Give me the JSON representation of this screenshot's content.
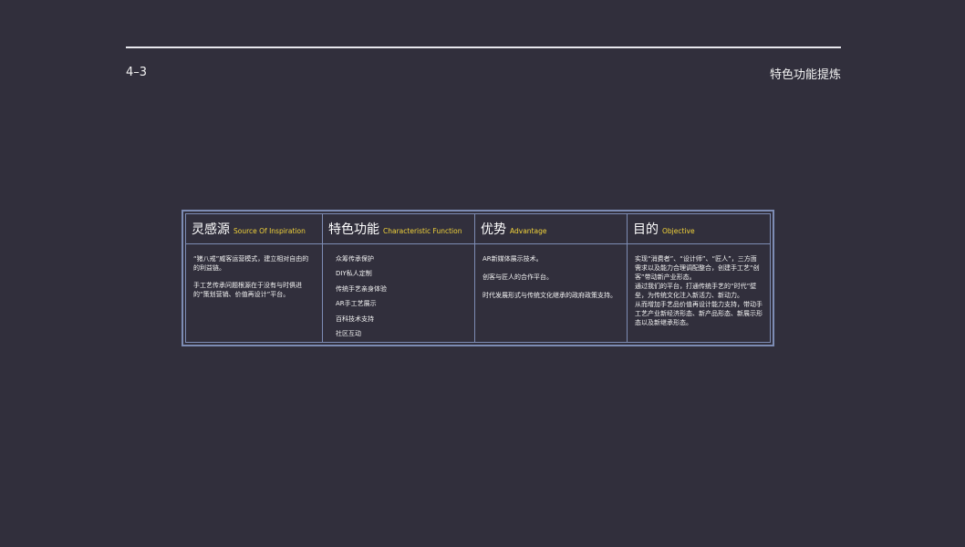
{
  "header": {
    "page_number": "4–3",
    "section_title": "特色功能提炼"
  },
  "table": {
    "columns": [
      {
        "title_zh": "灵感源",
        "title_en": "Source Of Inspiration",
        "paragraphs": [
          "“猪八戒”威客运营模式，建立相对自由的的利益链。",
          "手工艺传承问题根源在于没有与时俱进的“策划营销、价值再设计”平台。"
        ]
      },
      {
        "title_zh": "特色功能",
        "title_en": "Characteristic Function",
        "items": [
          "众筹传承保护",
          "DIY私人定制",
          "传统手艺亲身体验",
          "AR手工艺展示",
          "百科技术支持",
          "社区互动"
        ]
      },
      {
        "title_zh": "优势",
        "title_en": "Advantage",
        "paragraphs": [
          "AR新媒体展示技术。",
          "创客与匠人的合作平台。",
          "时代发展形式与传统文化继承的政府政策支持。"
        ]
      },
      {
        "title_zh": "目的",
        "title_en": "Objective",
        "paragraphs": [
          "实现“消费者”、“设计师”、“匠人”，三方面需求以及能力合理调配整合，创建手工艺“创客”带动新产业形态。",
          "通过我们的平台，打通传统手艺的“时代”壁垒，为传统文化注入新活力、新动力。",
          "从而增加手艺品价值再设计能力支持，带动手工艺产业新经济形态、新产品形态、新展示形态以及新继承形态。"
        ]
      }
    ]
  },
  "colors": {
    "background": "#312f3c",
    "border": "#7d8cb4",
    "accent_yellow": "#f2d33a"
  }
}
